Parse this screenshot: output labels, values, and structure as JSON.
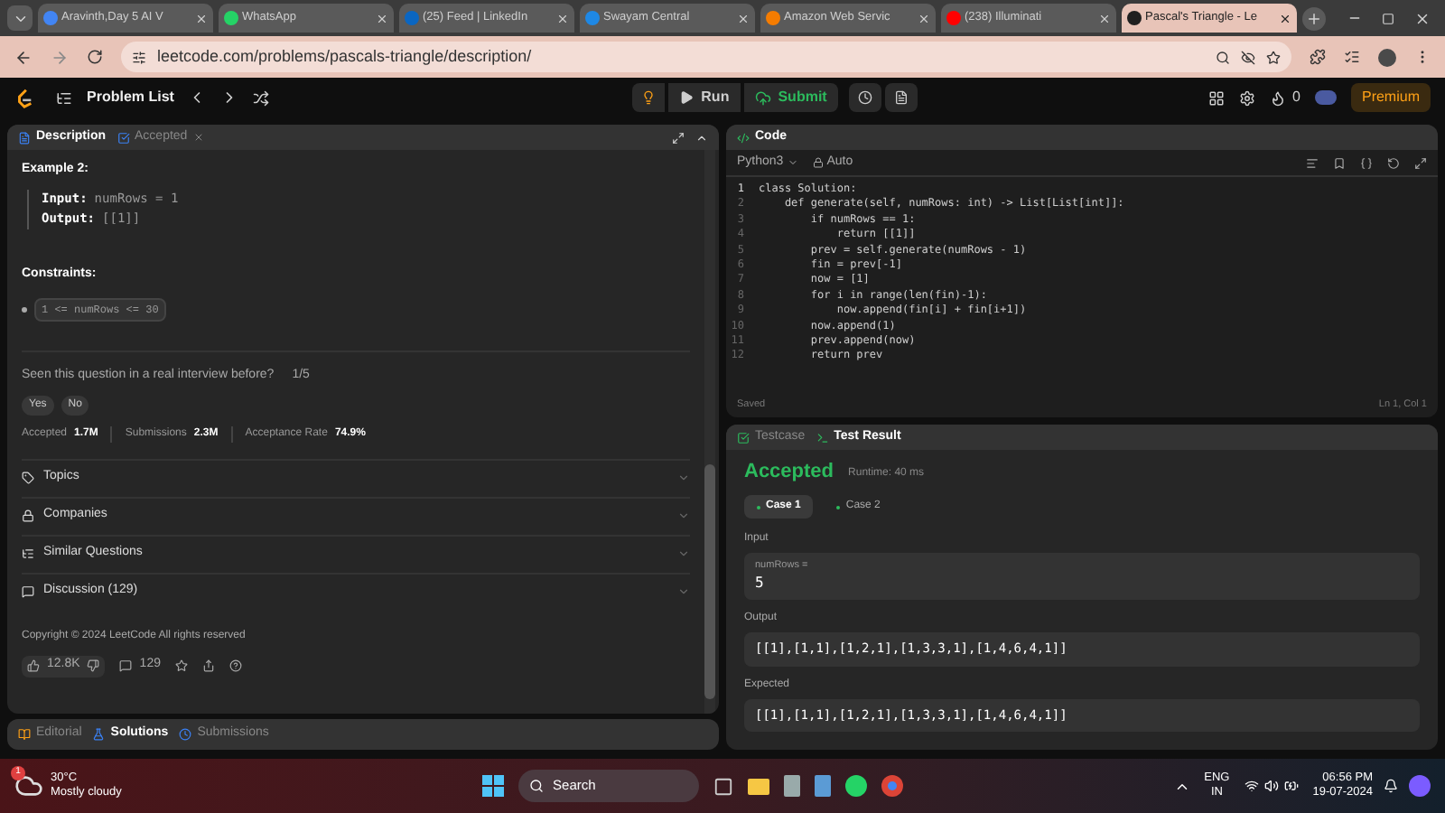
{
  "browser": {
    "tabs": [
      {
        "label": "Aravinth,Day 5 AI V",
        "selected": false,
        "color": "#4285f4"
      },
      {
        "label": "WhatsApp",
        "selected": false,
        "color": "#25d366"
      },
      {
        "label": "(25) Feed | LinkedIn",
        "selected": false,
        "color": "#0a66c2"
      },
      {
        "label": "Swayam Central",
        "selected": false,
        "color": "#1e88e5"
      },
      {
        "label": "Amazon Web Servic",
        "selected": false,
        "color": "#f57c00"
      },
      {
        "label": "(238) Illuminati",
        "selected": false,
        "color": "#ff0000"
      },
      {
        "label": "Pascal's Triangle - Le",
        "selected": true,
        "color": "#202020"
      }
    ],
    "url": "leetcode.com/problems/pascals-triangle/description/"
  },
  "header": {
    "problem_list": "Problem List",
    "run": "Run",
    "submit": "Submit",
    "streak": "0",
    "premium": "Premium"
  },
  "description_panel": {
    "tabs": [
      {
        "label": "Description",
        "selected": true
      },
      {
        "label": "Accepted",
        "selected": false
      }
    ],
    "example_title": "Example 2:",
    "example_lines": [
      {
        "label": "Input:",
        "value": "numRows = 1"
      },
      {
        "label": "Output:",
        "value": "[[1]]"
      }
    ],
    "constraints_title": "Constraints:",
    "constraints": [
      "1 <= numRows <= 30"
    ],
    "interview_question": "Seen this question in a real interview before?",
    "interview_count": "1/5",
    "answers": [
      "Yes",
      "No"
    ],
    "stats": [
      {
        "label": "Accepted",
        "value": "1.7M"
      },
      {
        "label": "Submissions",
        "value": "2.3M"
      },
      {
        "label": "Acceptance Rate",
        "value": "74.9%"
      }
    ],
    "sections": [
      {
        "kind": "tag",
        "label": "Topics"
      },
      {
        "kind": "lock",
        "label": "Companies"
      },
      {
        "kind": "list",
        "label": "Similar Questions"
      },
      {
        "kind": "chat",
        "label": "Discussion (129)"
      }
    ],
    "copyright": "Copyright © 2024 LeetCode All rights reserved",
    "likes": "12.8K",
    "comments": "129"
  },
  "bottom_tabs": [
    {
      "label": "Editorial",
      "selected": false
    },
    {
      "label": "Solutions",
      "selected": true
    },
    {
      "label": "Submissions",
      "selected": false
    }
  ],
  "code_panel": {
    "title": "Code",
    "language": "Python3",
    "mode": "Auto",
    "lines": [
      {
        "number": "1",
        "text": "class Solution:"
      },
      {
        "number": "2",
        "text": "    def generate(self, numRows: int) -> List[List[int]]:"
      },
      {
        "number": "3",
        "text": "        if numRows == 1:"
      },
      {
        "number": "4",
        "text": "            return [[1]]"
      },
      {
        "number": "5",
        "text": "        prev = self.generate(numRows - 1)"
      },
      {
        "number": "6",
        "text": "        fin = prev[-1]"
      },
      {
        "number": "7",
        "text": "        now = [1]"
      },
      {
        "number": "8",
        "text": "        for i in range(len(fin)-1):"
      },
      {
        "number": "9",
        "text": "            now.append(fin[i] + fin[i+1])"
      },
      {
        "number": "10",
        "text": "        now.append(1)"
      },
      {
        "number": "11",
        "text": "        prev.append(now)"
      },
      {
        "number": "12",
        "text": "        return prev"
      }
    ],
    "status": "Saved",
    "cursor": "Ln 1, Col 1"
  },
  "result_panel": {
    "tabs": [
      {
        "label": "Testcase",
        "selected": false
      },
      {
        "label": "Test Result",
        "selected": true
      }
    ],
    "verdict": "Accepted",
    "runtime": "Runtime: 40 ms",
    "cases": [
      {
        "label": "Case 1",
        "selected": true
      },
      {
        "label": "Case 2",
        "selected": false
      }
    ],
    "input_label": "Input",
    "input_name": "numRows =",
    "input_value": "5",
    "output_label": "Output",
    "output_value": "[[1],[1,1],[1,2,1],[1,3,3,1],[1,4,6,4,1]]",
    "expected_label": "Expected",
    "expected_value": "[[1],[1,1],[1,2,1],[1,3,3,1],[1,4,6,4,1]]"
  },
  "taskbar": {
    "temperature": "30°C",
    "weather": "Mostly cloudy",
    "weather_badge": "1",
    "search": "Search",
    "language": "ENG",
    "region": "IN",
    "time": "06:56 PM",
    "date": "19-07-2024"
  }
}
